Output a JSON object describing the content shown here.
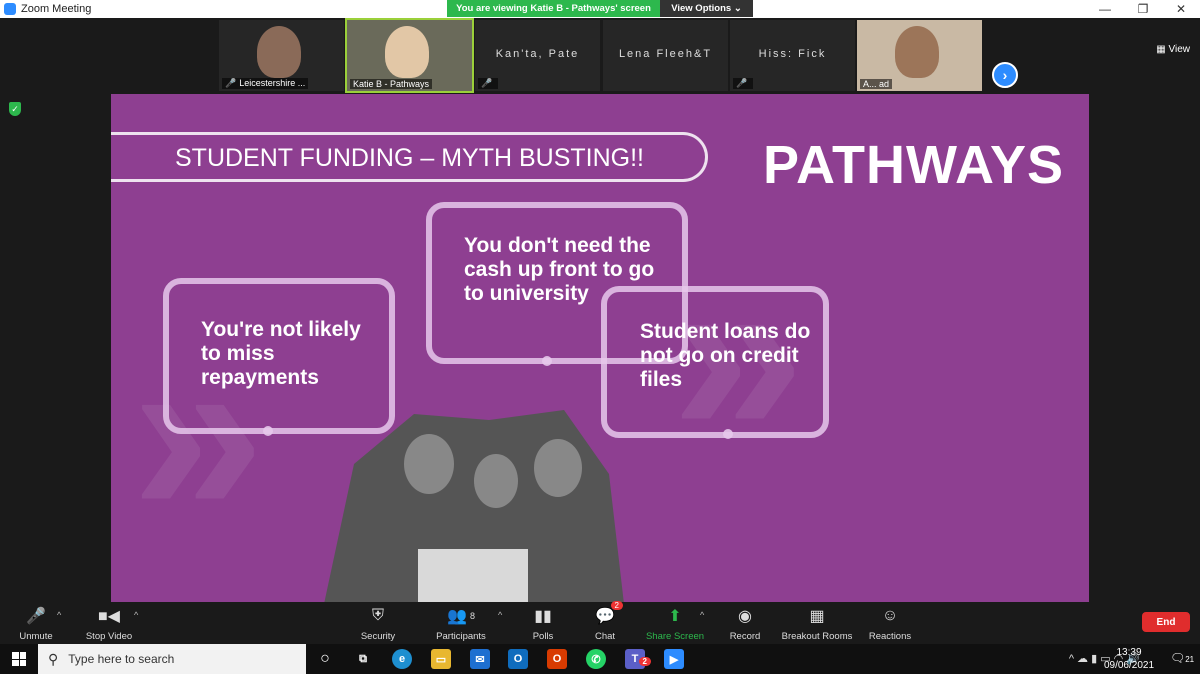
{
  "window": {
    "title": "Zoom Meeting",
    "minimize": "—",
    "maximize": "❐",
    "close": "✕"
  },
  "banner": {
    "viewing": "You are viewing Katie B - Pathways' screen",
    "view_options": "View Options ⌄"
  },
  "view_button": "▦ View",
  "thumbnails": [
    {
      "name": "Leicestershire ...",
      "muted": true
    },
    {
      "name": "Katie B - Pathways",
      "muted": false
    },
    {
      "name": "",
      "muted": true,
      "big_name": "Kan'ta, Pate"
    },
    {
      "name": "",
      "muted": false,
      "big_name": "Lena Fleeh&T"
    },
    {
      "name": "",
      "muted": true,
      "big_name": "Hiss: Fick"
    },
    {
      "name": "A... ad",
      "muted": false
    }
  ],
  "slide": {
    "headline": "STUDENT FUNDING – MYTH BUSTING!!",
    "logo": "PATHWAYS",
    "bubble1": "You're not likely to miss repayments",
    "bubble2": "You don't need the cash up front to go to university",
    "bubble3": "Student loans do not go on credit files"
  },
  "toolbar": {
    "unmute": "Unmute",
    "stop_video": "Stop Video",
    "security": "Security",
    "participants": "Participants",
    "participants_count": "8",
    "polls": "Polls",
    "chat": "Chat",
    "chat_badge": "2",
    "share_screen": "Share Screen",
    "record": "Record",
    "breakout": "Breakout Rooms",
    "reactions": "Reactions",
    "end": "End"
  },
  "taskbar": {
    "search_placeholder": "Type here to search",
    "time": "13:39",
    "date": "09/06/2021",
    "notifications": "21",
    "teams_badge": "2"
  },
  "colors": {
    "slide_bg": "#8e3f91",
    "zoom_blue": "#2d8cff",
    "green": "#2db84d",
    "end_red": "#e02d2d"
  }
}
